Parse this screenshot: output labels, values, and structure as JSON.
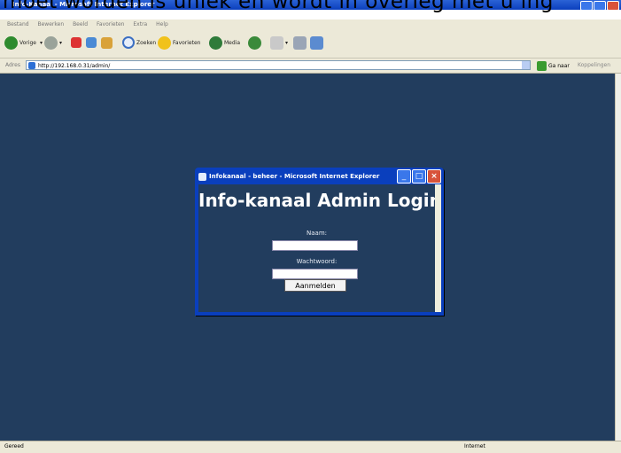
{
  "caption": "moet worden is uniek en wordt in overleg met u ing",
  "window": {
    "title": "Info-Kanaal - Microsoft Internet Explorer"
  },
  "menu": [
    "Bestand",
    "Bewerken",
    "Beeld",
    "Favorieten",
    "Extra",
    "Help"
  ],
  "toolbar": {
    "back": "Vorige",
    "search": "Zoeken",
    "favorites": "Favorieten",
    "media": "Media"
  },
  "address": {
    "label": "Adres",
    "url": "http://192.168.0.31/admin/",
    "go": "Ga naar",
    "links": "Koppelingen"
  },
  "status": {
    "text": "Gereed",
    "zone": "Internet"
  },
  "popup": {
    "title": "Infokanaal - beheer - Microsoft Internet Explorer",
    "heading": "Info-kanaal Admin Login",
    "name_label": "Naam:",
    "password_label": "Wachtwoord:",
    "submit_label": "Aanmelden"
  },
  "colors": {
    "page_bg": "#223d5e",
    "titlebar": "#0a3fbd"
  }
}
